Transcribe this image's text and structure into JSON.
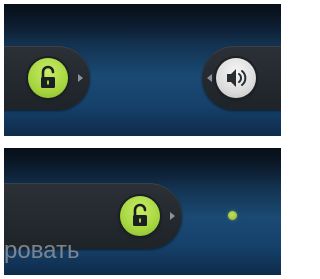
{
  "top_panel": {
    "lock_icon": "unlocked-padlock-icon",
    "sound_icon": "speaker-icon"
  },
  "bottom_panel": {
    "slide_label": "ровать",
    "lock_icon": "unlocked-padlock-icon",
    "target_icon": "target-dot-icon"
  },
  "colors": {
    "accent_green": "#a6d63f",
    "pill_dark": "#22272c",
    "background_blue": "#1a4a74",
    "label_gray": "#7c858d"
  }
}
